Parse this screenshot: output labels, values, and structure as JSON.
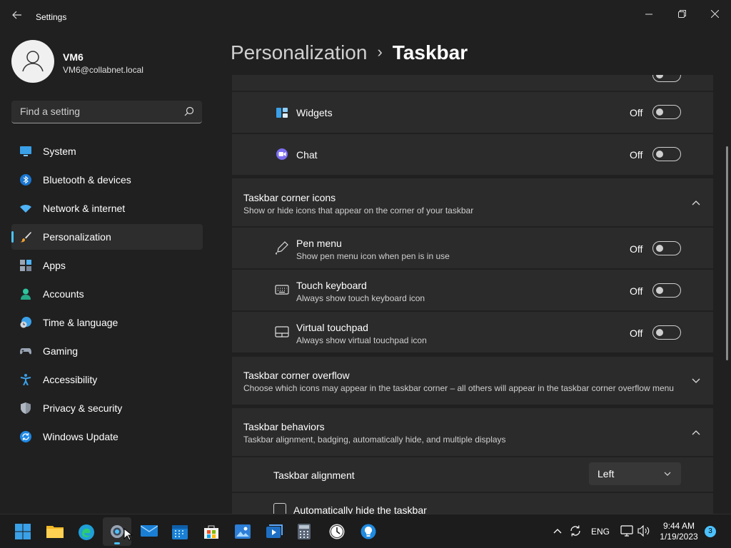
{
  "app": {
    "title": "Settings"
  },
  "user": {
    "name": "VM6",
    "email": "VM6@collabnet.local"
  },
  "search": {
    "placeholder": "Find a setting"
  },
  "nav": [
    {
      "label": "System",
      "icon": "monitor-icon"
    },
    {
      "label": "Bluetooth & devices",
      "icon": "bluetooth-icon"
    },
    {
      "label": "Network & internet",
      "icon": "wifi-icon"
    },
    {
      "label": "Personalization",
      "icon": "brush-icon",
      "selected": true
    },
    {
      "label": "Apps",
      "icon": "apps-icon"
    },
    {
      "label": "Accounts",
      "icon": "person-icon"
    },
    {
      "label": "Time & language",
      "icon": "globe-clock-icon"
    },
    {
      "label": "Gaming",
      "icon": "gamepad-icon"
    },
    {
      "label": "Accessibility",
      "icon": "accessibility-icon"
    },
    {
      "label": "Privacy & security",
      "icon": "shield-icon"
    },
    {
      "label": "Windows Update",
      "icon": "update-icon"
    }
  ],
  "breadcrumb": {
    "parent": "Personalization",
    "current": "Taskbar"
  },
  "taskbar_items": {
    "widgets": {
      "label": "Widgets",
      "state": "Off"
    },
    "chat": {
      "label": "Chat",
      "state": "Off"
    }
  },
  "corner_icons": {
    "title": "Taskbar corner icons",
    "subtitle": "Show or hide icons that appear on the corner of your taskbar",
    "pen": {
      "title": "Pen menu",
      "subtitle": "Show pen menu icon when pen is in use",
      "state": "Off"
    },
    "touch_keyboard": {
      "title": "Touch keyboard",
      "subtitle": "Always show touch keyboard icon",
      "state": "Off"
    },
    "virtual_touchpad": {
      "title": "Virtual touchpad",
      "subtitle": "Always show virtual touchpad icon",
      "state": "Off"
    }
  },
  "corner_overflow": {
    "title": "Taskbar corner overflow",
    "subtitle": "Choose which icons may appear in the taskbar corner – all others will appear in the taskbar corner overflow menu"
  },
  "behaviors": {
    "title": "Taskbar behaviors",
    "subtitle": "Taskbar alignment, badging, automatically hide, and multiple displays",
    "alignment_label": "Taskbar alignment",
    "alignment_value": "Left",
    "autohide_label": "Automatically hide the taskbar"
  },
  "tray": {
    "language": "ENG",
    "time": "9:44 AM",
    "date": "1/19/2023",
    "notifications": "3"
  },
  "colors": {
    "accent": "#4cc2ff",
    "background": "#202020",
    "card": "#2b2b2b"
  }
}
